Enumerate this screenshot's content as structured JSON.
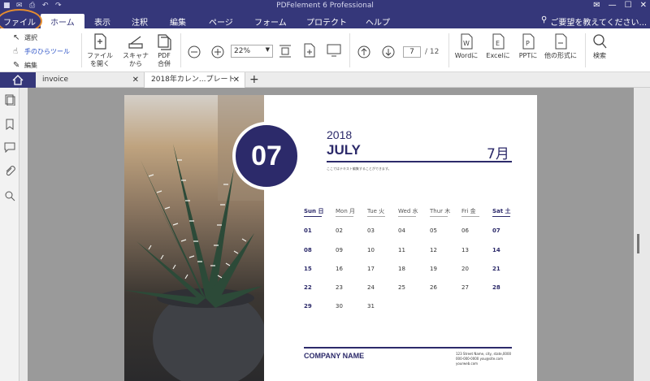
{
  "app": {
    "title": "PDFelement 6 Professional"
  },
  "menu": {
    "file": "ファイル",
    "home": "ホーム",
    "view": "表示",
    "comment": "注釈",
    "edit": "編集",
    "page": "ページ",
    "form": "フォーム",
    "protect": "プロテクト",
    "help": "ヘルプ",
    "search_hint": "ご要望を教えてください..."
  },
  "ribbon": {
    "select": "選択",
    "hand": "手のひらツール",
    "edit": "編集",
    "open_file_1": "ファイル",
    "open_file_2": "を開く",
    "scanner_1": "スキャナ",
    "scanner_2": "から",
    "combine_1": "PDF",
    "combine_2": "合併",
    "zoom": "22%",
    "page_current": "7",
    "page_total": "/ 12",
    "to_word": "Wordに",
    "to_excel": "Excelに",
    "to_ppt": "PPTに",
    "to_other": "他の形式に",
    "search": "検索"
  },
  "tabs": [
    {
      "label": "invoice"
    },
    {
      "label": "2018年カレン...プレート"
    }
  ],
  "calendar": {
    "badge": "07",
    "year": "2018",
    "month_en": "JULY",
    "month_jp": "7月",
    "subtitle": "ここではテキスト編集することができます。",
    "days": [
      "Sun 日",
      "Mon 月",
      "Tue 火",
      "Wed 水",
      "Thur 木",
      "Fri 金",
      "Sat 土"
    ],
    "weeks": [
      [
        "01",
        "02",
        "03",
        "04",
        "05",
        "06",
        "07"
      ],
      [
        "08",
        "09",
        "10",
        "11",
        "12",
        "13",
        "14"
      ],
      [
        "15",
        "16",
        "17",
        "18",
        "19",
        "20",
        "21"
      ],
      [
        "22",
        "23",
        "24",
        "25",
        "26",
        "27",
        "28"
      ],
      [
        "29",
        "30",
        "31",
        "",
        "",
        "",
        ""
      ]
    ],
    "company": "COMPANY NAME",
    "address": "123 Street Name, city, state,0000",
    "phone": "000-000-0000 you@site.com",
    "web": "yourweb.com"
  },
  "colors": {
    "brand": "#35377a",
    "accent": "#2c2a6a",
    "highlight": "#e48c2f"
  }
}
